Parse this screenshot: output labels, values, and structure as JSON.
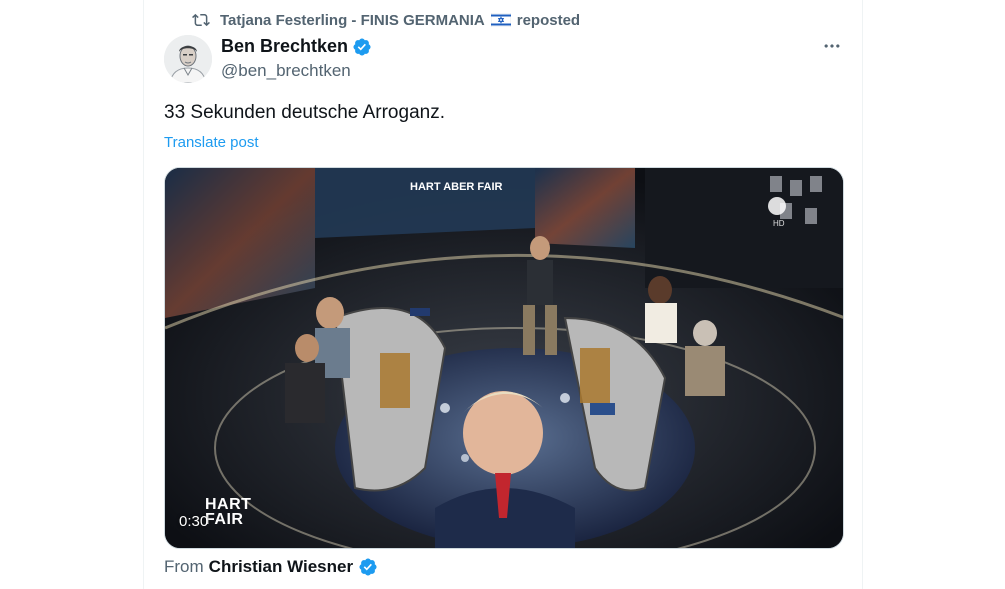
{
  "repost": {
    "reposter": "Tatjana Festerling - FINIS GERMANIA",
    "flag_icon": "israel-flag-icon",
    "suffix": "reposted"
  },
  "author": {
    "name": "Ben Brechtken",
    "handle": "@ben_brechtken",
    "verified": true
  },
  "post": {
    "text": "33 Sekunden deutsche Arroganz.",
    "translate_label": "Translate post"
  },
  "media": {
    "duration": "0:30",
    "watermark": "HART\nFAIR",
    "studio_logo": "HART ABER FAIR",
    "channel_badge": "HD"
  },
  "source": {
    "label": "From",
    "name": "Christian Wiesner",
    "verified": true
  },
  "colors": {
    "accent": "#1d9bf0",
    "secondary_text": "#536471",
    "primary_text": "#0f1419"
  }
}
